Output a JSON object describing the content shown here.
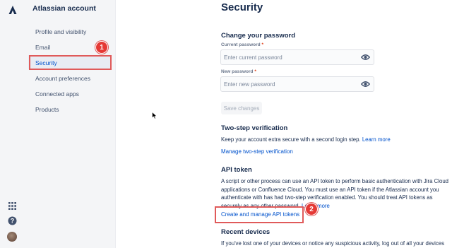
{
  "app": {
    "title": "Atlassian account"
  },
  "sidebar": {
    "items": [
      {
        "label": "Profile and visibility"
      },
      {
        "label": "Email"
      },
      {
        "label": "Security"
      },
      {
        "label": "Account preferences"
      },
      {
        "label": "Connected apps"
      },
      {
        "label": "Products"
      }
    ],
    "active_item": "Security"
  },
  "rail": {
    "icons": [
      "atlassian-logo-icon",
      "app-switcher-icon",
      "help-icon",
      "avatar"
    ]
  },
  "annotations": {
    "step1": "1",
    "step2": "2",
    "highlight_color": "#e05a5a"
  },
  "main": {
    "page_title": "Security",
    "change_password": {
      "heading": "Change your password",
      "current_label": "Current password",
      "current_placeholder": "Enter current password",
      "new_label": "New password",
      "new_placeholder": "Enter new password",
      "required_mark": "*",
      "save_button": "Save changes"
    },
    "two_step": {
      "heading": "Two-step verification",
      "text": "Keep your account extra secure with a second login step.",
      "learn_more": "Learn more",
      "manage_link": "Manage two-step verification"
    },
    "api_token": {
      "heading": "API token",
      "text_line1": "A script or other process can use an API token to perform basic authentication with Jira Cloud",
      "text_line2": "applications or Confluence Cloud. You must use an API token if the Atlassian account you",
      "text_line3": "authenticate with has had two-step verification enabled. You should treat API tokens as",
      "text_line4": "securely as any other password.",
      "learn_more": "Learn more",
      "manage_link": "Create and manage API tokens"
    },
    "recent_devices": {
      "heading": "Recent devices",
      "text": "If you've lost one of your devices or notice any suspicious activity, log out of all your devices"
    }
  },
  "colors": {
    "brand_blue": "#0052cc",
    "text_dark": "#172b4d",
    "sidebar_bg": "#f4f5f7",
    "annotation_red": "#e53935"
  }
}
